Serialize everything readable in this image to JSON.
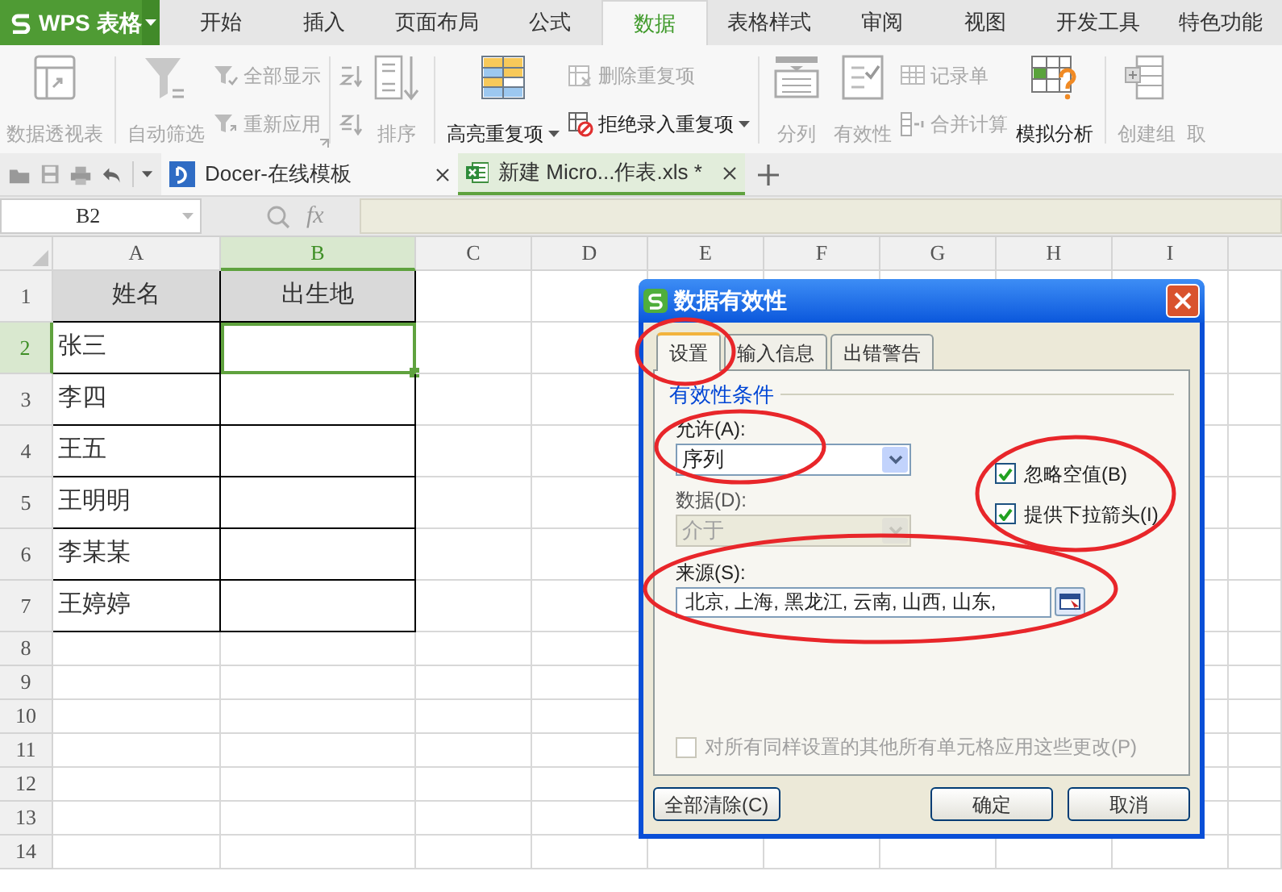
{
  "app": {
    "name": "WPS 表格"
  },
  "menu_tabs": [
    {
      "label": "开始",
      "selected": false
    },
    {
      "label": "插入",
      "selected": false
    },
    {
      "label": "页面布局",
      "selected": false
    },
    {
      "label": "公式",
      "selected": false
    },
    {
      "label": "数据",
      "selected": true
    },
    {
      "label": "表格样式",
      "selected": false
    },
    {
      "label": "审阅",
      "selected": false
    },
    {
      "label": "视图",
      "selected": false
    },
    {
      "label": "开发工具",
      "selected": false
    },
    {
      "label": "特色功能",
      "selected": false
    }
  ],
  "ribbon": [
    {
      "items": [
        {
          "kind": "big",
          "label": "数据透视表",
          "disabled": true
        }
      ]
    },
    {
      "items": [
        {
          "kind": "big",
          "label": "自动筛选",
          "disabled": true
        },
        {
          "kind": "stack",
          "items": [
            {
              "label": "全部显示",
              "disabled": true
            },
            {
              "label": "重新应用",
              "disabled": true
            }
          ]
        }
      ]
    },
    {
      "items": [
        {
          "kind": "icon-stack"
        },
        {
          "kind": "big",
          "label": "排序",
          "disabled": true
        }
      ]
    },
    {
      "items": [
        {
          "kind": "big",
          "label": "高亮重复项",
          "disabled": false,
          "dropdown": true
        },
        {
          "kind": "stack",
          "items": [
            {
              "label": "删除重复项",
              "disabled": true
            },
            {
              "label": "拒绝录入重复项",
              "disabled": false,
              "dropdown": true
            }
          ]
        }
      ]
    },
    {
      "items": [
        {
          "kind": "big",
          "label": "分列",
          "disabled": true
        },
        {
          "kind": "big",
          "label": "有效性",
          "disabled": true
        },
        {
          "kind": "stack",
          "items": [
            {
              "label": "记录单",
              "disabled": true
            },
            {
              "label": "合并计算",
              "disabled": true
            }
          ]
        },
        {
          "kind": "big",
          "label": "模拟分析",
          "disabled": false
        }
      ]
    },
    {
      "items": [
        {
          "kind": "big",
          "label": "创建组",
          "disabled": true
        },
        {
          "kind": "big",
          "label": "取",
          "disabled": true
        }
      ]
    }
  ],
  "doc_tabs": [
    {
      "label": "Docer-在线模板",
      "selected": false
    },
    {
      "label": "新建 Micro...作表.xls *",
      "selected": true
    }
  ],
  "name_box": {
    "value": "B2"
  },
  "formula_label": "fx",
  "sheet": {
    "columns": [
      {
        "label": "A",
        "selected": false
      },
      {
        "label": "B",
        "selected": true
      },
      {
        "label": "C",
        "selected": false
      },
      {
        "label": "D",
        "selected": false
      },
      {
        "label": "E",
        "selected": false
      },
      {
        "label": "F",
        "selected": false
      },
      {
        "label": "G",
        "selected": false
      },
      {
        "label": "H",
        "selected": false
      },
      {
        "label": "I",
        "selected": false
      }
    ],
    "rows": [
      {
        "label": "1",
        "kind": "header",
        "selected": false,
        "cells": [
          "姓名",
          "出生地"
        ]
      },
      {
        "label": "2",
        "kind": "data",
        "selected": true,
        "cells": [
          "张三"
        ]
      },
      {
        "label": "3",
        "kind": "data",
        "selected": false,
        "cells": [
          "李四"
        ]
      },
      {
        "label": "4",
        "kind": "data",
        "selected": false,
        "cells": [
          "王五"
        ]
      },
      {
        "label": "5",
        "kind": "data",
        "selected": false,
        "cells": [
          "王明明"
        ]
      },
      {
        "label": "6",
        "kind": "data",
        "selected": false,
        "cells": [
          "李某某"
        ]
      },
      {
        "label": "7",
        "kind": "data",
        "selected": false,
        "cells": [
          "王婷婷"
        ]
      },
      {
        "label": "8",
        "kind": "empty",
        "selected": false
      },
      {
        "label": "9",
        "kind": "empty",
        "selected": false
      },
      {
        "label": "10",
        "kind": "empty",
        "selected": false
      },
      {
        "label": "11",
        "kind": "empty",
        "selected": false
      },
      {
        "label": "12",
        "kind": "empty",
        "selected": false
      },
      {
        "label": "13",
        "kind": "empty",
        "selected": false
      },
      {
        "label": "14",
        "kind": "empty",
        "selected": false
      }
    ]
  },
  "dialog": {
    "title": "数据有效性",
    "tabs": [
      {
        "label": "设置",
        "selected": true
      },
      {
        "label": "输入信息",
        "selected": false
      },
      {
        "label": "出错警告",
        "selected": false
      }
    ],
    "group_label": "有效性条件",
    "allow": {
      "label": "允许(A):",
      "value": "序列",
      "disabled": false
    },
    "data": {
      "label": "数据(D):",
      "value": "介于",
      "disabled": true
    },
    "options": [
      {
        "label": "忽略空值(B)",
        "checked": true
      },
      {
        "label": "提供下拉箭头(I)",
        "checked": true
      }
    ],
    "source": {
      "label": "来源(S):",
      "value": "北京, 上海, 黑龙江, 云南, 山西, 山东,"
    },
    "apply_all": {
      "label": "对所有同样设置的其他所有单元格应用这些更改(P)",
      "checked": false,
      "disabled": true
    },
    "buttons": [
      {
        "label": "全部清除(C)",
        "kind": "left"
      },
      {
        "label": "确定",
        "kind": "right"
      },
      {
        "label": "取消",
        "kind": "right"
      }
    ]
  }
}
